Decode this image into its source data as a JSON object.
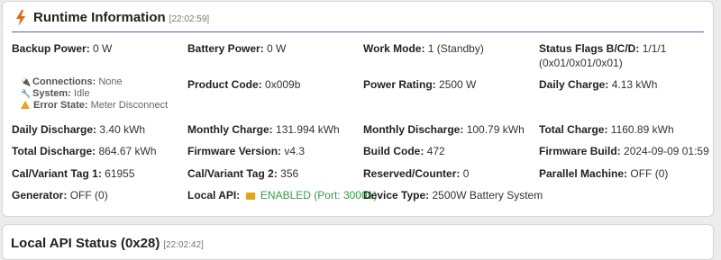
{
  "runtime": {
    "title": "Runtime Information",
    "timestamp": "[22:02:59]",
    "icon": "lightning-bolt-icon",
    "accent_color": "#e8650c",
    "fields": {
      "backup_power": {
        "label": "Backup Power:",
        "value": "0 W"
      },
      "battery_power": {
        "label": "Battery Power:",
        "value": "0 W"
      },
      "work_mode": {
        "label": "Work Mode:",
        "value": "1 (Standby)"
      },
      "status_flags": {
        "label": "Status Flags B/C/D:",
        "value": "1/1/1",
        "value2": "(0x01/0x01/0x01)"
      },
      "product_code": {
        "label": "Product Code:",
        "value": "0x009b"
      },
      "power_rating": {
        "label": "Power Rating:",
        "value": "2500 W"
      },
      "daily_charge": {
        "label": "Daily Charge:",
        "value": "4.13 kWh"
      },
      "daily_discharge": {
        "label": "Daily Discharge:",
        "value": "3.40 kWh"
      },
      "monthly_charge": {
        "label": "Monthly Charge:",
        "value": "131.994 kWh"
      },
      "monthly_discharge": {
        "label": "Monthly Discharge:",
        "value": "100.79 kWh"
      },
      "total_charge": {
        "label": "Total Charge:",
        "value": "1160.89 kWh"
      },
      "total_discharge": {
        "label": "Total Discharge:",
        "value": "864.67 kWh"
      },
      "firmware_version": {
        "label": "Firmware Version:",
        "value": "v4.3"
      },
      "build_code": {
        "label": "Build Code:",
        "value": "472"
      },
      "firmware_build": {
        "label": "Firmware Build:",
        "value": "2024-09-09 01:59"
      },
      "cal_tag1": {
        "label": "Cal/Variant Tag 1:",
        "value": "61955"
      },
      "cal_tag2": {
        "label": "Cal/Variant Tag 2:",
        "value": "356"
      },
      "reserved_counter": {
        "label": "Reserved/Counter:",
        "value": "0"
      },
      "parallel_machine": {
        "label": "Parallel Machine:",
        "value": "OFF (0)"
      },
      "generator": {
        "label": "Generator:",
        "value": "OFF (0)"
      },
      "local_api": {
        "label": "Local API:",
        "value": "ENABLED (Port: 30001)",
        "color": "#2f9e44"
      },
      "device_type": {
        "label": "Device Type:",
        "value": "2500W Battery System"
      }
    },
    "sub_status": {
      "connections": {
        "label": "Connections:",
        "value": "None",
        "icon": "plug-icon"
      },
      "system": {
        "label": "System:",
        "value": "Idle",
        "icon": "wrench-icon"
      },
      "error_state": {
        "label": "Error State:",
        "value": "Meter Disconnect",
        "icon": "warning-icon"
      }
    }
  },
  "local_api_status": {
    "title": "Local API Status (0x28)",
    "timestamp": "[22:02:42]"
  }
}
